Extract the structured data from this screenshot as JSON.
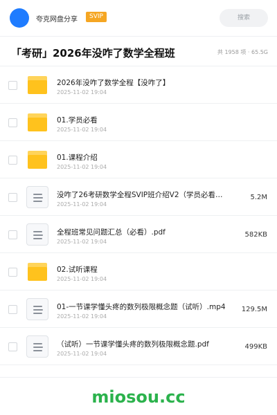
{
  "header": {
    "brand": "夸克网盘分享",
    "badge": "SVIP",
    "search_placeholder": "搜索",
    "brand_color": "#1f7cff",
    "badge_color": "#f5a623"
  },
  "share": {
    "title": "「考研」2026年没咋了数学全程班",
    "meta": "共 1958 项 · 65.5G"
  },
  "files": [
    {
      "type": "folder",
      "name": "2026年没咋了数学全程【没咋了】",
      "date": "2025-11-02 19:04",
      "size": ""
    },
    {
      "type": "folder",
      "name": "01.学员必看",
      "date": "2025-11-02 19:04",
      "size": ""
    },
    {
      "type": "folder",
      "name": "01.课程介绍",
      "date": "2025-11-02 19:04",
      "size": ""
    },
    {
      "type": "file",
      "name": "没咋了26考研数学全程SVIP班介绍V2（学员必看…",
      "date": "2025-11-02 19:04",
      "size": "5.2M"
    },
    {
      "type": "file",
      "name": "全程班常见问题汇总（必看）.pdf",
      "date": "2025-11-02 19:04",
      "size": "582KB"
    },
    {
      "type": "folder",
      "name": "02.试听课程",
      "date": "2025-11-02 19:04",
      "size": ""
    },
    {
      "type": "file",
      "name": "01-一节课学懂头疼的数列极限概念题（试听）.mp4",
      "date": "2025-11-02 19:04",
      "size": "129.5M"
    },
    {
      "type": "file",
      "name": "（试听）一节课学懂头疼的数列极限概念题.pdf",
      "date": "2025-11-02 19:04",
      "size": "499KB"
    }
  ],
  "icons": {
    "folder": "folder-icon",
    "file": "document-icon"
  },
  "footer": {
    "watermark": "miosou.cc",
    "watermark_color": "#2bb24c"
  }
}
